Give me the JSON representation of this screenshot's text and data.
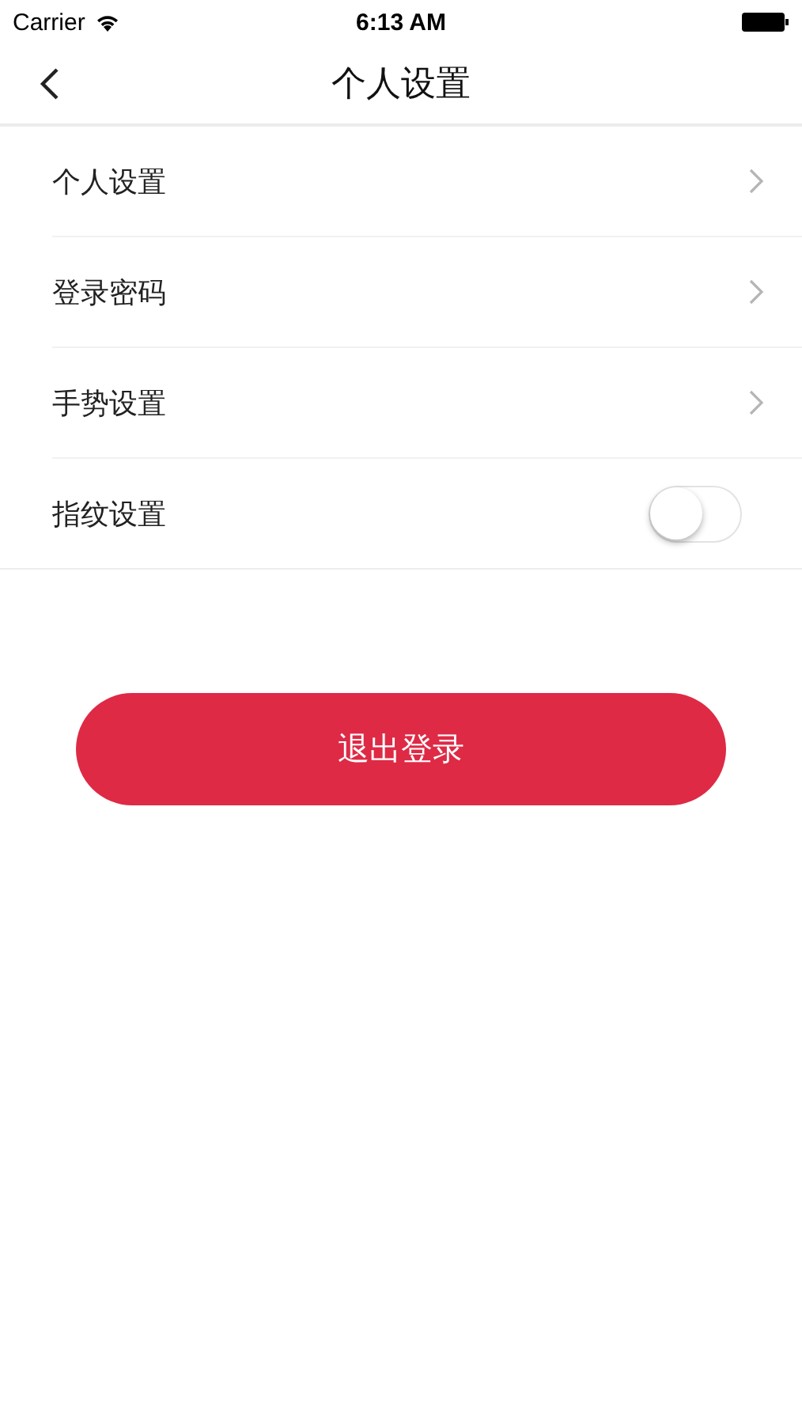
{
  "status_bar": {
    "carrier": "Carrier",
    "time": "6:13 AM"
  },
  "nav": {
    "title": "个人设置"
  },
  "settings": [
    {
      "kind": "link",
      "label": "个人设置"
    },
    {
      "kind": "link",
      "label": "登录密码"
    },
    {
      "kind": "link",
      "label": "手势设置"
    },
    {
      "kind": "toggle",
      "label": "指纹设置",
      "on": false
    }
  ],
  "logout_button": "退出登录"
}
